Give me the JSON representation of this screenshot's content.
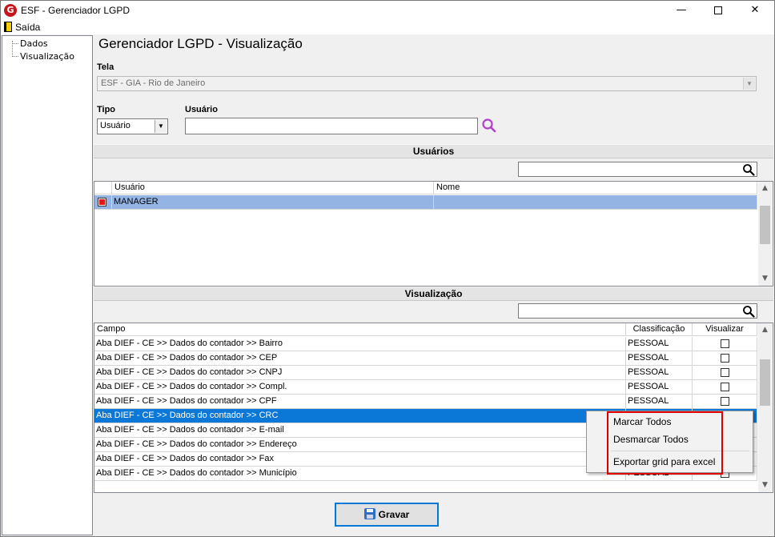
{
  "window": {
    "app_icon_letter": "G",
    "title": "ESF - Gerenciador LGPD",
    "minimize": "—",
    "close": "✕"
  },
  "menu": {
    "saida": "Saída"
  },
  "tree": {
    "items": [
      "Dados",
      "Visualização"
    ]
  },
  "main": {
    "title": "Gerenciador LGPD - Visualização",
    "tela_label": "Tela",
    "tela_value": "ESF - GIA - Rio de Janeiro",
    "tipo_label": "Tipo",
    "tipo_value": "Usuário",
    "usuario_label": "Usuário",
    "usuario_value": ""
  },
  "usuarios_section": {
    "header": "Usuários",
    "filter_value": "",
    "columns": [
      "Usuário",
      "Nome"
    ],
    "rows": [
      {
        "usuario": "MANAGER",
        "nome": "",
        "checked": true
      }
    ]
  },
  "visualizacao_section": {
    "header": "Visualização",
    "filter_value": "",
    "columns": [
      "Campo",
      "Classificação",
      "Visualizar"
    ],
    "rows": [
      {
        "campo": "Aba DIEF - CE >> Dados do contador >> Bairro",
        "classificacao": "PESSOAL"
      },
      {
        "campo": "Aba DIEF - CE >> Dados do contador >> CEP",
        "classificacao": "PESSOAL"
      },
      {
        "campo": "Aba DIEF - CE >> Dados do contador >> CNPJ",
        "classificacao": "PESSOAL"
      },
      {
        "campo": "Aba DIEF - CE >> Dados do contador >> Compl.",
        "classificacao": "PESSOAL"
      },
      {
        "campo": "Aba DIEF - CE >> Dados do contador >> CPF",
        "classificacao": "PESSOAL"
      },
      {
        "campo": "Aba DIEF - CE >> Dados do contador >> CRC",
        "classificacao": ""
      },
      {
        "campo": "Aba DIEF - CE >> Dados do contador >> E-mail",
        "classificacao": ""
      },
      {
        "campo": "Aba DIEF - CE >> Dados do contador >> Endereço",
        "classificacao": ""
      },
      {
        "campo": "Aba DIEF - CE >> Dados do contador >> Fax",
        "classificacao": ""
      },
      {
        "campo": "Aba DIEF - CE >> Dados do contador >> Município",
        "classificacao": "PESSOAL"
      }
    ]
  },
  "context_menu": {
    "items": [
      "Marcar Todos",
      "Desmarcar Todos",
      "Exportar grid para excel"
    ]
  },
  "footer": {
    "save_label": "Gravar"
  },
  "colors": {
    "selected_row": "#0b78d8",
    "checked_row": "#94b4e4",
    "highlight_border": "#e00000",
    "search_icon": "#b040c8"
  }
}
